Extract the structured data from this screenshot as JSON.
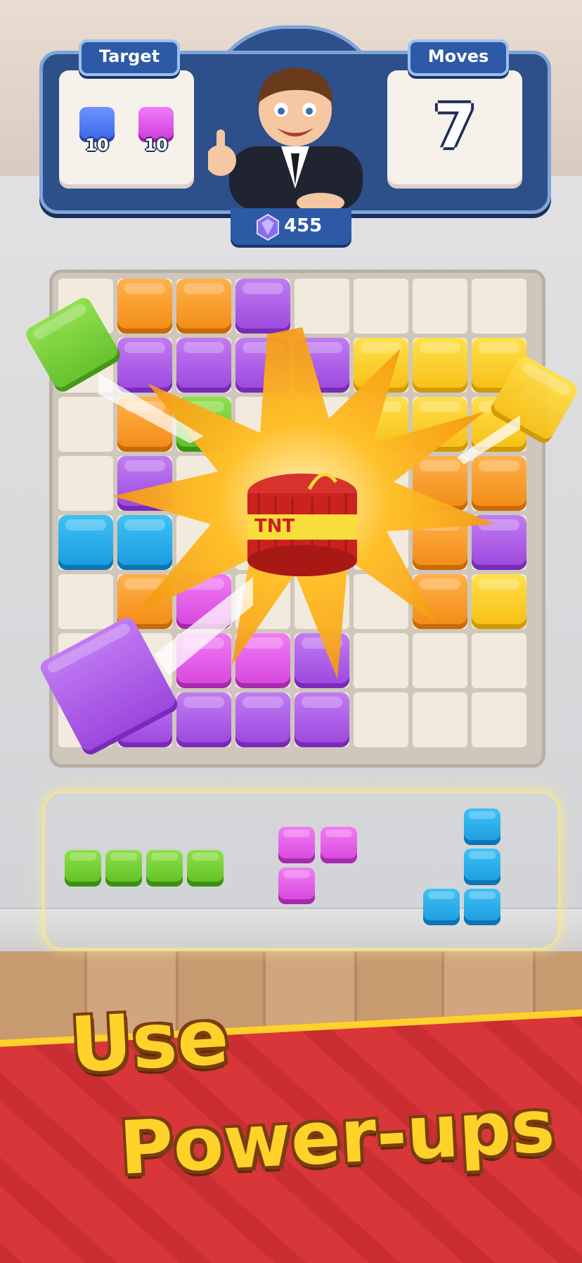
{
  "header": {
    "target_label": "Target",
    "moves_label": "Moves",
    "moves_value": "7",
    "targets": [
      {
        "color": "blue",
        "count": "10"
      },
      {
        "color": "pink",
        "count": "10"
      }
    ],
    "gems": "455"
  },
  "board": {
    "size": 8,
    "rows": [
      [
        "",
        "orange",
        "orange",
        "purple",
        "",
        "",
        "",
        ""
      ],
      [
        "",
        "purple",
        "purple",
        "purple",
        "purple",
        "yellow",
        "yellow",
        "yellow"
      ],
      [
        "",
        "orange",
        "green",
        "",
        "",
        "yellow",
        "yellow",
        "yellow"
      ],
      [
        "",
        "purple",
        "",
        "",
        "",
        "",
        "orange",
        "orange"
      ],
      [
        "blue",
        "blue",
        "",
        "",
        "",
        "",
        "orange",
        "purple"
      ],
      [
        "",
        "orange",
        "pink",
        "",
        "",
        "",
        "orange",
        "yellow"
      ],
      [
        "",
        "",
        "pink",
        "pink",
        "purple",
        "",
        "",
        ""
      ],
      [
        "",
        "purple",
        "purple",
        "purple",
        "purple",
        "",
        "",
        ""
      ]
    ],
    "powerup_label": "TNT"
  },
  "tray": {
    "pieces": [
      {
        "color": "green",
        "shape": "I4-horizontal"
      },
      {
        "color": "pink",
        "shape": "L3"
      },
      {
        "color": "blue",
        "shape": "J4"
      }
    ]
  },
  "headline": {
    "line1": "Use",
    "line2": "Power-ups"
  },
  "colors": {
    "orange": "#f28a14",
    "purple": "#9a45dd",
    "yellow": "#f7be12",
    "blue": "#1a99df",
    "pink": "#d544db",
    "green": "#5cbf22",
    "banner": "#d9363a",
    "headline": "#ffd22a"
  }
}
